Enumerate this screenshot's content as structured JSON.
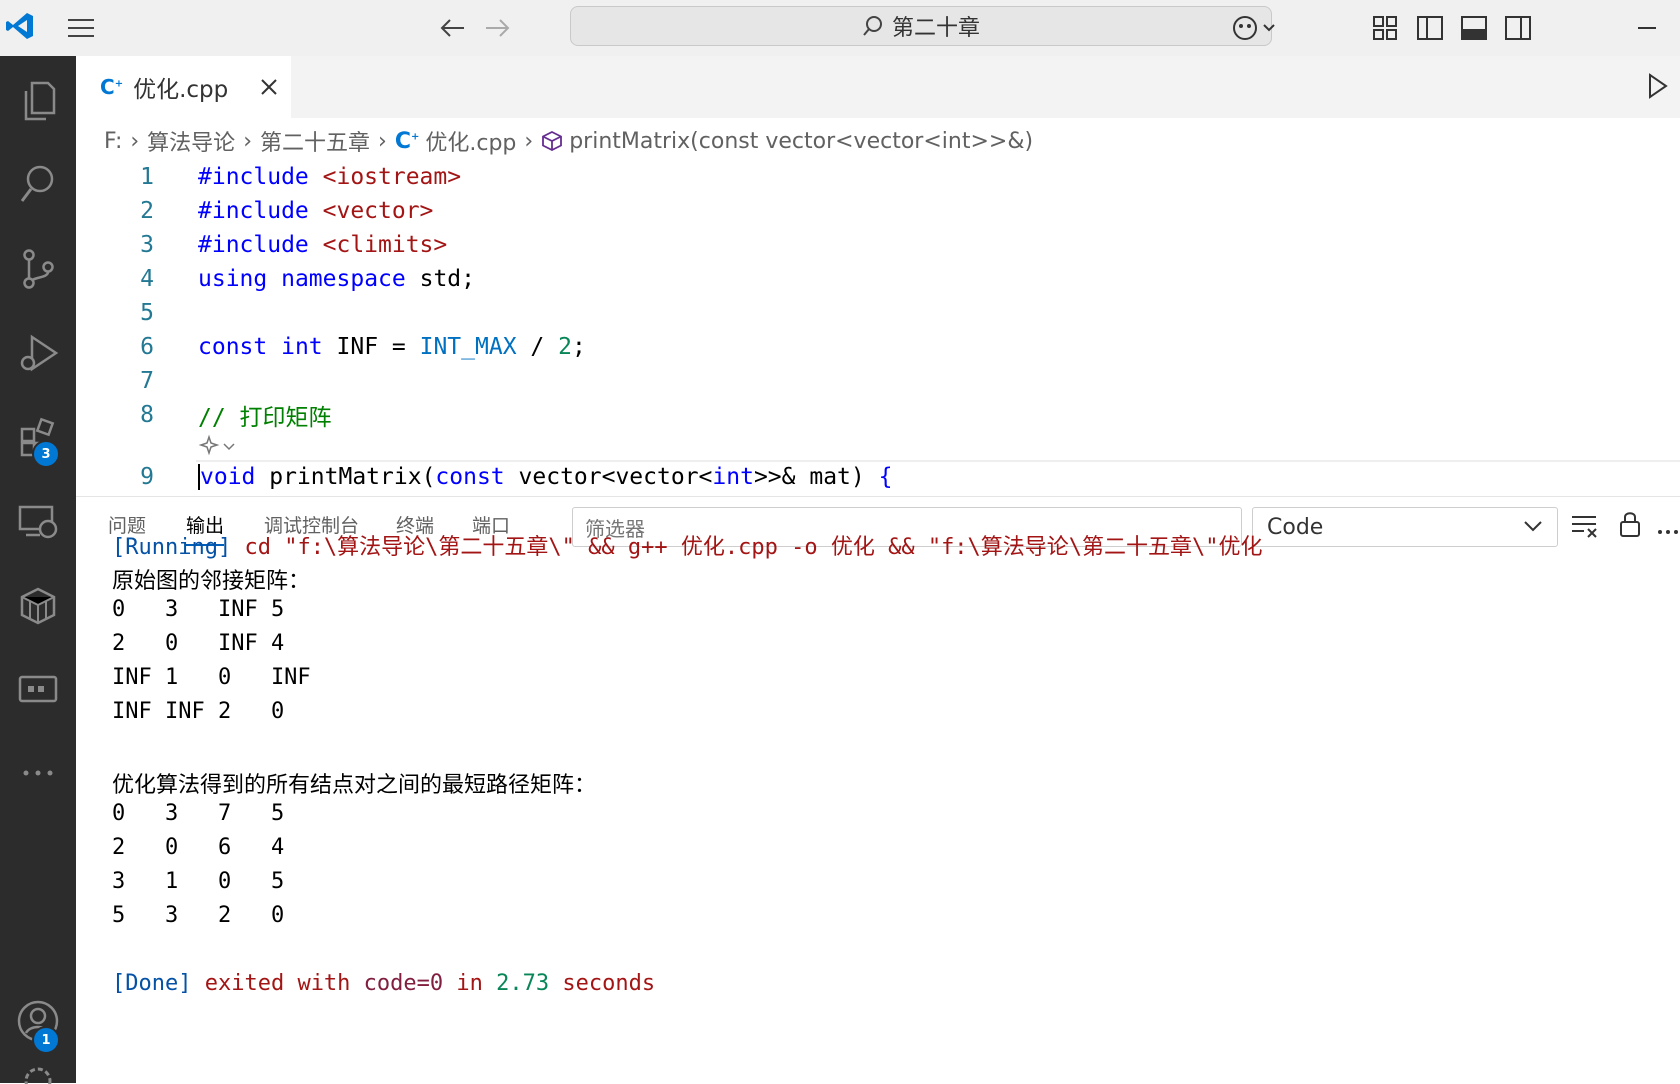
{
  "titlebar": {
    "search_text": "第二十章"
  },
  "activity_bar": {
    "extensions_badge": "3",
    "accounts_badge": "1"
  },
  "tab": {
    "label": "优化.cpp"
  },
  "breadcrumb": [
    "F:",
    "算法导论",
    "第二十五章",
    "优化.cpp",
    "printMatrix(const vector<vector<int>>&)"
  ],
  "editor": {
    "lines": [
      {
        "n": "1",
        "text": "#include <iostream>"
      },
      {
        "n": "2",
        "text": "#include <vector>"
      },
      {
        "n": "3",
        "text": "#include <climits>"
      },
      {
        "n": "4",
        "text": "using namespace std;"
      },
      {
        "n": "5",
        "text": ""
      },
      {
        "n": "6",
        "text": "const int INF = INT_MAX / 2;"
      },
      {
        "n": "7",
        "text": ""
      },
      {
        "n": "8",
        "text": "// 打印矩阵"
      },
      {
        "n": "9",
        "text": "void printMatrix(const vector<vector<int>>& mat) {"
      }
    ]
  },
  "panel": {
    "tabs": [
      "问题",
      "输出",
      "调试控制台",
      "终端",
      "端口"
    ],
    "active_tab": "输出",
    "filter_placeholder": "筛选器",
    "dropdown_value": "Code",
    "output": {
      "running_prefix": "[Running]",
      "running_cmd": " cd \"f:\\算法导论\\第二十五章\\\" && g++ 优化.cpp -o 优化 && \"f:\\算法导论\\第二十五章\\\"优化",
      "heading1": "原始图的邻接矩阵：",
      "matrix1": [
        "0   3   INF 5",
        "2   0   INF 4",
        "INF 1   0   INF",
        "INF INF 2   0"
      ],
      "heading2": "优化算法得到的所有结点对之间的最短路径矩阵：",
      "matrix2": [
        "0   3   7   5",
        "2   0   6   4",
        "3   1   0   5",
        "5   3   2   0"
      ],
      "done_prefix": "[Done]",
      "done_text_1": " exited with ",
      "done_code": "code=0",
      "done_text_2": " in ",
      "done_time": "2.73",
      "done_text_3": " seconds"
    }
  }
}
